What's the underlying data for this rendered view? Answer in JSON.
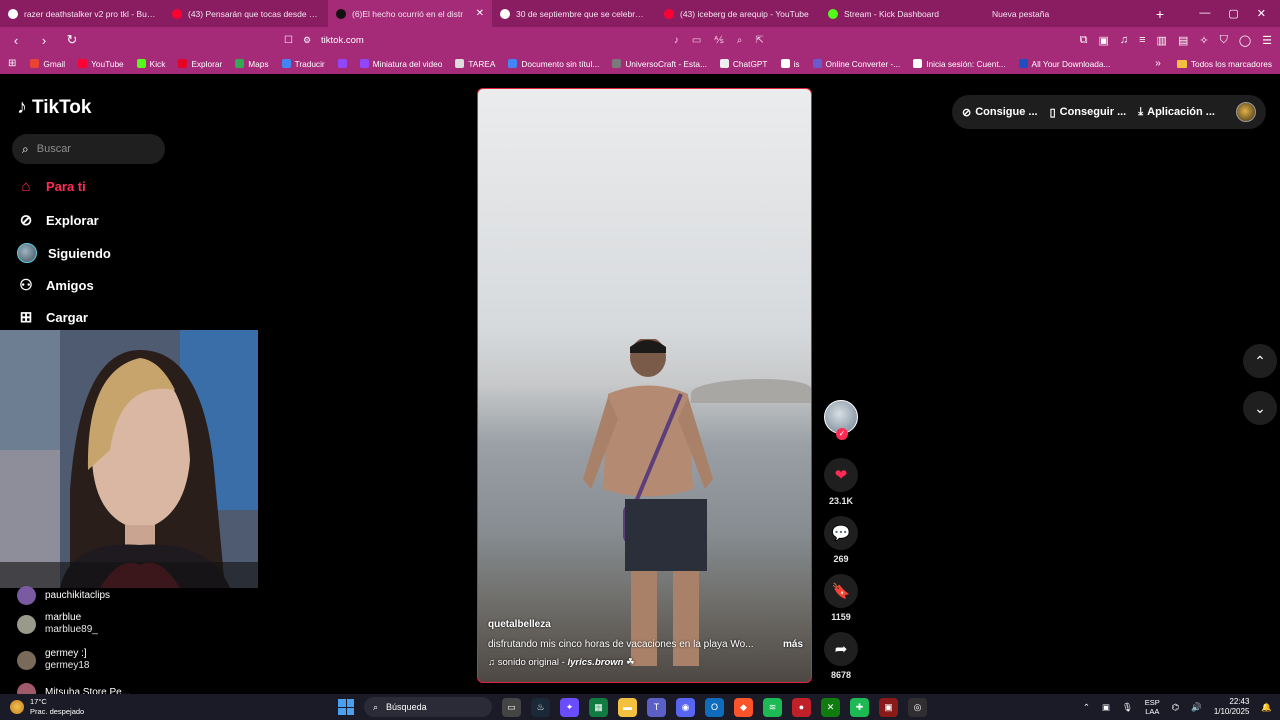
{
  "browser": {
    "tabs": [
      {
        "title": "razer deathstalker v2 pro tkl - Busca",
        "color": "#ffffff",
        "active": false
      },
      {
        "title": "(43) Pensarán que tocas desde hace",
        "color": "#ff0033",
        "active": false
      },
      {
        "title": "(6)El hecho ocurrió en el distr",
        "color": "#111111",
        "active": true
      },
      {
        "title": "30 de septiembre que se celebra - B",
        "color": "#ffffff",
        "active": false
      },
      {
        "title": "(43) iceberg de arequip - YouTube",
        "color": "#ff0033",
        "active": false
      },
      {
        "title": "Stream - Kick Dashboard",
        "color": "#53fc18",
        "active": false
      },
      {
        "title": "Nueva pestaña",
        "color": "",
        "active": false
      }
    ],
    "new_tab": "+",
    "window_controls": [
      "—",
      "▢",
      "✕"
    ],
    "url": "tiktok.com",
    "bookmarks": [
      {
        "label": "Gmail",
        "color": "#ea4335"
      },
      {
        "label": "YouTube",
        "color": "#ff0033"
      },
      {
        "label": "Kick",
        "color": "#53fc18"
      },
      {
        "label": "Explorar",
        "color": "#e60023"
      },
      {
        "label": "Maps",
        "color": "#34a853"
      },
      {
        "label": "Traducir",
        "color": "#4285f4"
      },
      {
        "label": "",
        "color": "#9146ff"
      },
      {
        "label": "Miniatura del video",
        "color": "#9146ff"
      },
      {
        "label": "TAREA",
        "color": "#dddddd"
      },
      {
        "label": "Documento sin títul...",
        "color": "#4285f4"
      },
      {
        "label": "UniversoCraft - Esta...",
        "color": "#7a7a7a"
      },
      {
        "label": "ChatGPT",
        "color": "#eeeeee"
      },
      {
        "label": "is",
        "color": "#ffffff"
      },
      {
        "label": "Online Converter -...",
        "color": "#6a5acd"
      },
      {
        "label": "Inicia sesión: Cuent...",
        "color": "#ffffff"
      },
      {
        "label": "All Your Downloada...",
        "color": "#1f4fbf"
      }
    ],
    "bookmarks_more": "»",
    "bookmarks_folder": "Todos los marcadores"
  },
  "tiktok": {
    "logo": "TikTok",
    "search_placeholder": "Buscar",
    "nav": [
      {
        "label": "Para ti",
        "icon": "home-icon"
      },
      {
        "label": "Explorar",
        "icon": "compass-icon"
      },
      {
        "label": "Siguiendo",
        "icon": "avatar"
      },
      {
        "label": "Amigos",
        "icon": "friends-icon"
      },
      {
        "label": "Cargar",
        "icon": "upload-icon"
      }
    ],
    "following": [
      {
        "name": "pauchikitaclips",
        "handle": ""
      },
      {
        "name": "marblue",
        "handle": "marblue89_"
      },
      {
        "name": "germey :]",
        "handle": "germey18"
      },
      {
        "name": "Mitsuha Store Pe...",
        "handle": ""
      }
    ],
    "top_right": {
      "coins": "Consigue ...",
      "get_app": "Conseguir ...",
      "download": "Aplicación ..."
    },
    "video": {
      "author": "quetalbelleza",
      "description": "disfrutando mis cinco horas de vacaciones en la playa Wo...",
      "more": "más",
      "sound_prefix": "♫ sonido original - ",
      "sound_author": "lyrics.brown",
      "sound_suffix": " ☘"
    },
    "actions": {
      "likes": "23.1K",
      "comments": "269",
      "saves": "1159",
      "shares": "8678"
    }
  },
  "taskbar": {
    "weather_temp": "17°C",
    "weather_desc": "Prac. despejado",
    "search": "Búsqueda",
    "lang_top": "ESP",
    "lang_bottom": "LAA",
    "time": "22:43",
    "date": "1/10/2025"
  }
}
